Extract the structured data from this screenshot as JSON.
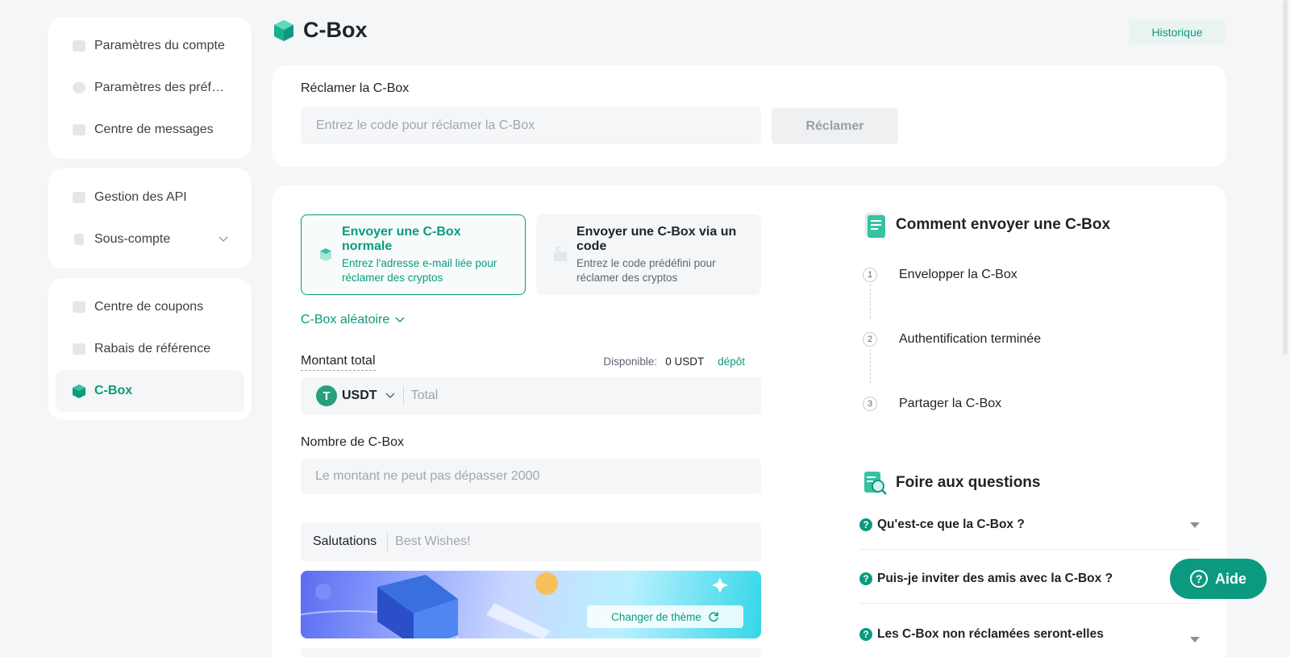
{
  "sidebar": {
    "group1": [
      {
        "label": "Paramètres du compte",
        "icon": "user-icon"
      },
      {
        "label": "Paramètres des préférences",
        "icon": "preferences-icon"
      },
      {
        "label": "Centre de messages",
        "icon": "message-icon"
      }
    ],
    "group2": [
      {
        "label": "Gestion des API",
        "icon": "api-icon"
      },
      {
        "label": "Sous-compte",
        "icon": "subaccount-icon"
      }
    ],
    "group3": [
      {
        "label": "Centre de coupons",
        "icon": "coupon-icon"
      },
      {
        "label": "Rabais de référence",
        "icon": "referral-icon"
      },
      {
        "label": "C-Box",
        "icon": "cbox-icon",
        "active": true
      }
    ]
  },
  "header": {
    "title": "C-Box",
    "history_label": "Historique"
  },
  "claim": {
    "label": "Réclamer la C-Box",
    "placeholder": "Entrez le code pour réclamer la C-Box",
    "button": "Réclamer"
  },
  "send": {
    "normal": {
      "title": "Envoyer une C-Box normale",
      "desc": "Entrez l'adresse e-mail liée pour réclamer des cryptos"
    },
    "code": {
      "title": "Envoyer une C-Box via un code",
      "desc": "Entrez le code prédéfini pour réclamer des cryptos"
    },
    "random_label": "C-Box aléatoire",
    "amount_label": "Montant total",
    "available_label": "Disponible:",
    "available_value": "0 USDT",
    "deposit_label": "dépôt",
    "coin": "USDT",
    "coin_symbol": "T",
    "total_placeholder": "Total",
    "count_label": "Nombre de C-Box",
    "count_placeholder": "Le montant ne peut pas dépasser 2000",
    "greeting_label": "Salutations",
    "greeting_placeholder": "Best Wishes!",
    "theme_button": "Changer de thème"
  },
  "how": {
    "title": "Comment envoyer une C-Box",
    "steps": [
      {
        "num": "1",
        "text": "Envelopper la C-Box"
      },
      {
        "num": "2",
        "text": "Authentification terminée"
      },
      {
        "num": "3",
        "text": "Partager la C-Box"
      }
    ]
  },
  "faq": {
    "title": "Foire aux questions",
    "q_symbol": "?",
    "items": [
      "Qu'est-ce que la C-Box ?",
      "Puis-je inviter des amis avec la C-Box ?",
      "Les C-Box non réclamées seront-elles"
    ]
  },
  "help": {
    "label": "Aide",
    "symbol": "?"
  },
  "colors": {
    "accent": "#0b9a7f",
    "background": "#f4f6f7"
  }
}
